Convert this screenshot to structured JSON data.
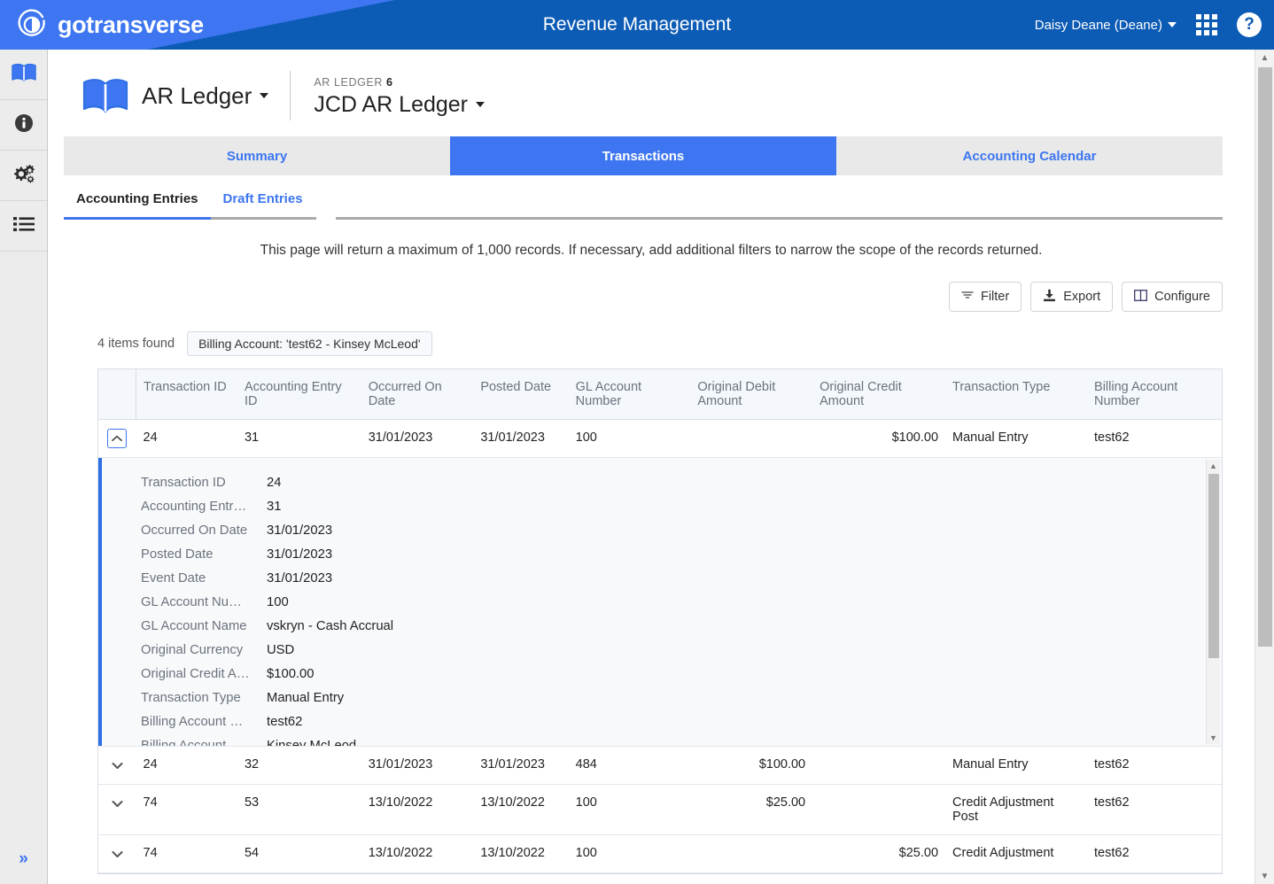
{
  "header": {
    "brand": "gotransverse",
    "app_title": "Revenue Management",
    "user": "Daisy Deane (Deane)",
    "apps_icon": "grid-apps-icon",
    "help_icon": "help-circle-icon",
    "colors": {
      "dark_blue": "#0c5bb5",
      "light_blue": "#3d76f0"
    }
  },
  "sidebar": {
    "items": [
      {
        "icon": "open-book-icon",
        "name": "ar-ledger"
      },
      {
        "icon": "info-circle-icon",
        "name": "info"
      },
      {
        "icon": "gears-icon",
        "name": "settings"
      },
      {
        "icon": "list-icon",
        "name": "list"
      }
    ],
    "expand_label": "»"
  },
  "page": {
    "icon": "open-book-icon",
    "title": "AR Ledger",
    "sub_label_prefix": "AR LEDGER",
    "sub_label_number": "6",
    "sub_name": "JCD AR Ledger"
  },
  "tabs": [
    {
      "label": "Summary",
      "active": false
    },
    {
      "label": "Transactions",
      "active": true
    },
    {
      "label": "Accounting Calendar",
      "active": false
    }
  ],
  "subtabs": [
    {
      "label": "Accounting Entries",
      "active": true
    },
    {
      "label": "Draft Entries",
      "active": false
    }
  ],
  "notice": "This page will return a maximum of 1,000 records. If necessary, add additional filters to narrow the scope of the records returned.",
  "toolbar": {
    "filter_label": "Filter",
    "export_label": "Export",
    "configure_label": "Configure"
  },
  "results": {
    "count_text": "4 items found",
    "chip": "Billing Account: 'test62 - Kinsey McLeod'"
  },
  "table": {
    "columns": [
      "Transaction ID",
      "Accounting Entry ID",
      "Occurred On Date",
      "Posted Date",
      "GL Account Number",
      "Original Debit Amount",
      "Original Credit Amount",
      "Transaction Type",
      "Billing Account Number"
    ],
    "rows": [
      {
        "expanded": true,
        "transaction_id": "24",
        "accounting_entry_id": "31",
        "occurred_on_date": "31/01/2023",
        "posted_date": "31/01/2023",
        "gl_account_number": "100",
        "original_debit_amount": "",
        "original_credit_amount": "$100.00",
        "transaction_type": "Manual Entry",
        "billing_account_number": "test62"
      },
      {
        "expanded": false,
        "transaction_id": "24",
        "accounting_entry_id": "32",
        "occurred_on_date": "31/01/2023",
        "posted_date": "31/01/2023",
        "gl_account_number": "484",
        "original_debit_amount": "$100.00",
        "original_credit_amount": "",
        "transaction_type": "Manual Entry",
        "billing_account_number": "test62"
      },
      {
        "expanded": false,
        "transaction_id": "74",
        "accounting_entry_id": "53",
        "occurred_on_date": "13/10/2022",
        "posted_date": "13/10/2022",
        "gl_account_number": "100",
        "original_debit_amount": "$25.00",
        "original_credit_amount": "",
        "transaction_type": "Credit Adjustment Post",
        "billing_account_number": "test62"
      },
      {
        "expanded": false,
        "transaction_id": "74",
        "accounting_entry_id": "54",
        "occurred_on_date": "13/10/2022",
        "posted_date": "13/10/2022",
        "gl_account_number": "100",
        "original_debit_amount": "",
        "original_credit_amount": "$25.00",
        "transaction_type": "Credit Adjustment",
        "billing_account_number": "test62"
      }
    ],
    "detail": [
      {
        "label": "Transaction ID",
        "value": "24"
      },
      {
        "label": "Accounting Entr…",
        "value": "31"
      },
      {
        "label": "Occurred On Date",
        "value": "31/01/2023"
      },
      {
        "label": "Posted Date",
        "value": "31/01/2023"
      },
      {
        "label": "Event Date",
        "value": "31/01/2023"
      },
      {
        "label": "GL Account Nu…",
        "value": "100"
      },
      {
        "label": "GL Account Name",
        "value": "vskryn - Cash  Accrual"
      },
      {
        "label": "Original Currency",
        "value": "USD"
      },
      {
        "label": "Original Credit A…",
        "value": "$100.00"
      },
      {
        "label": "Transaction Type",
        "value": "Manual Entry"
      },
      {
        "label": "Billing Account …",
        "value": "test62"
      },
      {
        "label": "Billing Account …",
        "value": "Kinsey  McLeod"
      }
    ]
  }
}
